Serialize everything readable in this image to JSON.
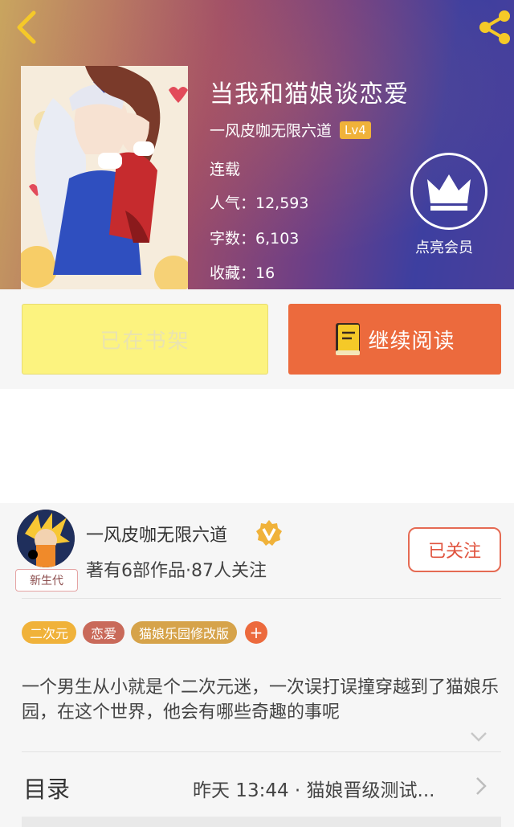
{
  "header": {
    "back_icon": "chevron-left-icon",
    "share_icon": "share-icon"
  },
  "book": {
    "title": "当我和猫娘谈恋爱",
    "author": "一风皮咖无限六道",
    "level": "Lv4",
    "status": "连载",
    "popularity": "人气：12,593",
    "word_count": "字数：6,103",
    "favorites": "收藏：16",
    "member_label": "点亮会员",
    "member_icon": "crown-icon"
  },
  "actions": {
    "shelf_label": "已在书架",
    "read_label": "继续阅读",
    "read_icon": "book-icon"
  },
  "uploader": {
    "name": "一风皮咖无限六道",
    "tag": "新生代",
    "meta": "著有6部作品·87人关注",
    "follow_label": "已关注",
    "verify_icon": "verified-v-icon"
  },
  "tags": [
    {
      "label": "二次元",
      "color": "#f0b23a"
    },
    {
      "label": "恋爱",
      "color": "#c96a5a"
    },
    {
      "label": "猫娘乐园修改版",
      "color": "#d6a34a"
    }
  ],
  "tag_add_label": "+",
  "description": "一个男生从小就是个二次元迷，一次误打误撞穿越到了猫娘乐园，在这个世界，他会有哪些奇趣的事呢",
  "toc": {
    "label": "目录",
    "latest": "昨天 13:44 · 猫娘晋级测试..."
  },
  "colors": {
    "accent": "#ec6a3d",
    "shelf_button": "#fcf37f",
    "follow": "#e0533e"
  }
}
